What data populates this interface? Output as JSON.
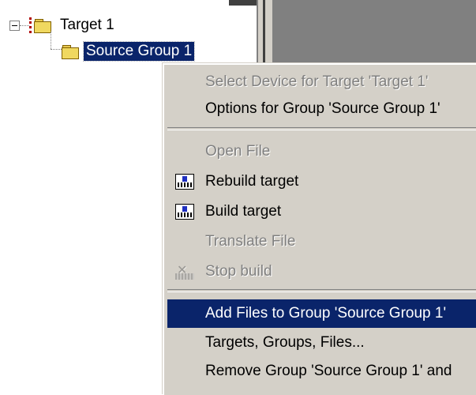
{
  "tree": {
    "target_label": "Target 1",
    "group_label": "Source Group 1"
  },
  "context_menu": {
    "items": [
      {
        "label": "Select Device for Target 'Target 1'",
        "enabled": false
      },
      {
        "label": "Options for Group 'Source Group 1'",
        "enabled": true
      },
      {
        "label": "Open File",
        "enabled": false
      },
      {
        "label": "Rebuild target",
        "enabled": true,
        "icon": "rebuild-icon"
      },
      {
        "label": "Build target",
        "enabled": true,
        "icon": "build-icon"
      },
      {
        "label": "Translate File",
        "enabled": false
      },
      {
        "label": "Stop build",
        "enabled": false,
        "icon": "stop-build-icon"
      },
      {
        "label": "Add Files to Group 'Source Group 1'",
        "enabled": true,
        "highlighted": true
      },
      {
        "label": "Targets, Groups, Files...",
        "enabled": true
      },
      {
        "label": "Remove Group 'Source Group 1' and",
        "enabled": true
      }
    ]
  },
  "colors": {
    "selection": "#0a246a",
    "menu_bg": "#d4d0c8",
    "disabled_text": "#808080"
  }
}
